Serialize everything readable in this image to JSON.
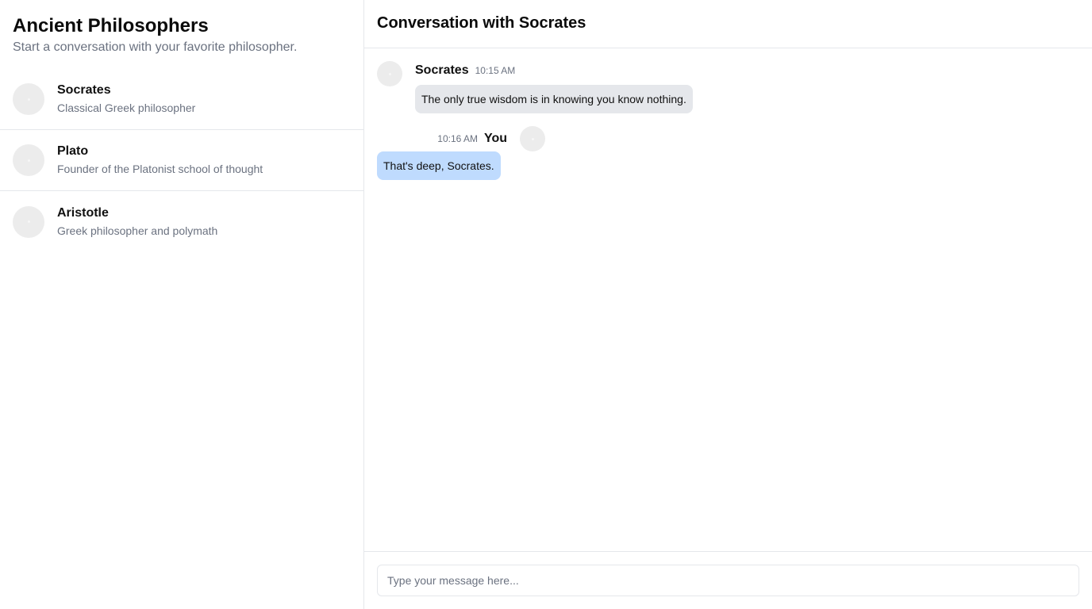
{
  "sidebar": {
    "title": "Ancient Philosophers",
    "subtitle": "Start a conversation with your favorite philosopher.",
    "contacts": [
      {
        "name": "Socrates",
        "description": "Classical Greek philosopher"
      },
      {
        "name": "Plato",
        "description": "Founder of the Platonist school of thought"
      },
      {
        "name": "Aristotle",
        "description": "Greek philosopher and polymath"
      }
    ]
  },
  "chat": {
    "title": "Conversation with Socrates",
    "messages": [
      {
        "sender": "Socrates",
        "time": "10:15 AM",
        "text": "The only true wisdom is in knowing you know nothing.",
        "direction": "incoming"
      },
      {
        "sender": "You",
        "time": "10:16 AM",
        "text": "That's deep, Socrates.",
        "direction": "outgoing"
      }
    ]
  },
  "composer": {
    "placeholder": "Type your message here..."
  },
  "colors": {
    "incoming_bubble": "#e5e7eb",
    "outgoing_bubble": "#bfdbfe",
    "avatar": "#ececec",
    "muted_text": "#6b7280",
    "border": "#e5e7eb"
  },
  "icons": {
    "avatar": "avatar-placeholder-icon"
  }
}
